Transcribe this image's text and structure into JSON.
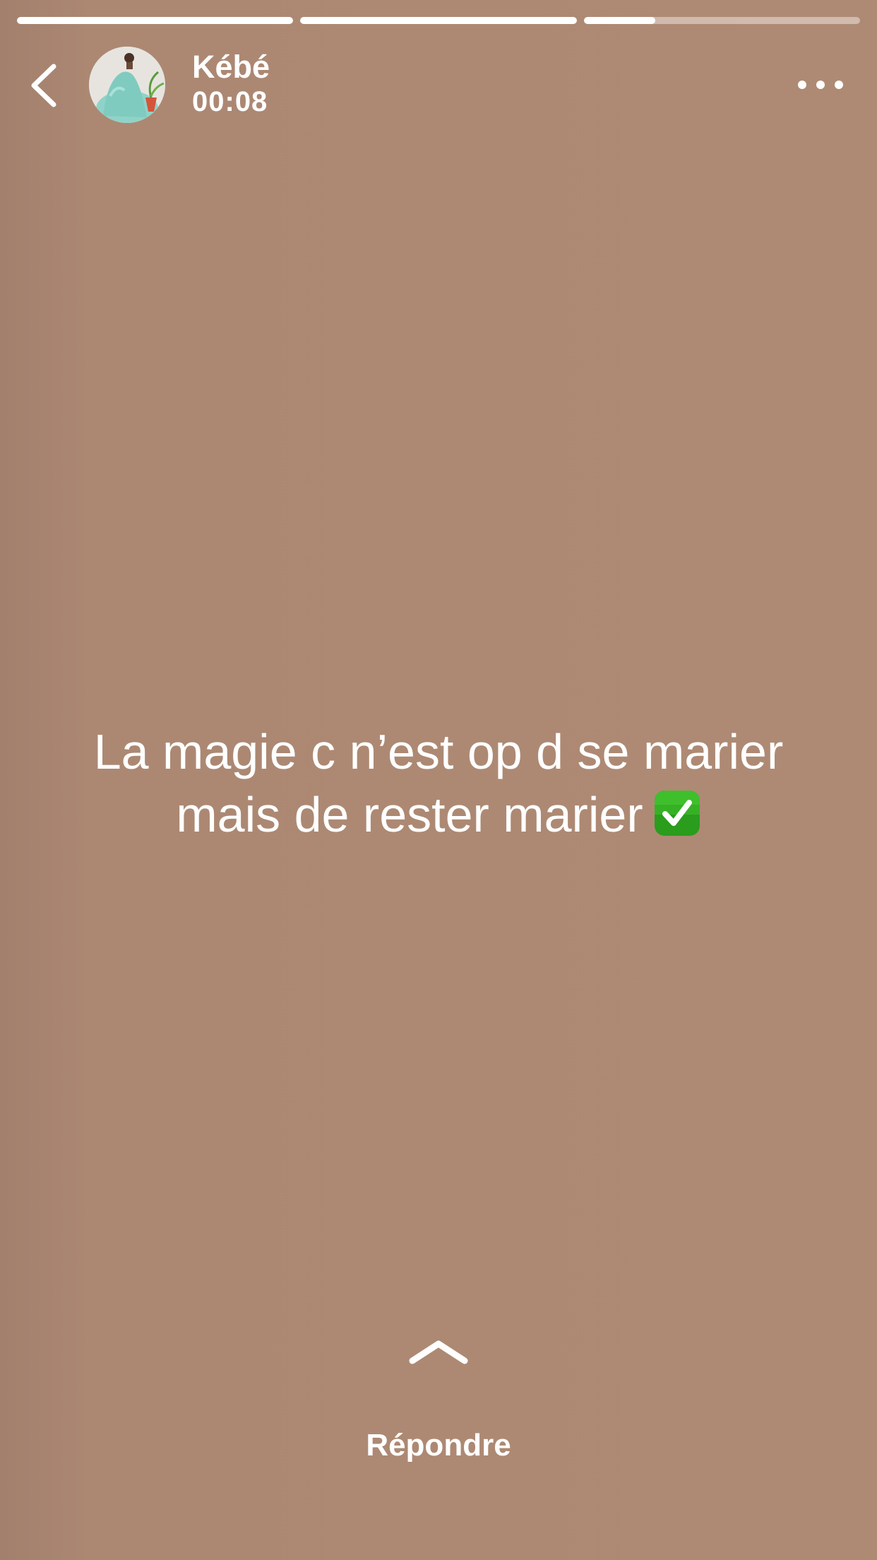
{
  "story": {
    "background_color": "#ad8973",
    "progress": [
      1,
      1,
      0.26
    ],
    "header": {
      "username": "Kébé",
      "time": "00:08",
      "back_icon": "chevron-left-icon",
      "more_icon": "more-horizontal-icon"
    },
    "caption": {
      "line1": "La magie c n’est op d se marier",
      "line2": "mais de rester marier",
      "emoji": "check-mark-button-icon"
    },
    "reply": {
      "icon": "chevron-up-icon",
      "label": "Répondre"
    }
  }
}
